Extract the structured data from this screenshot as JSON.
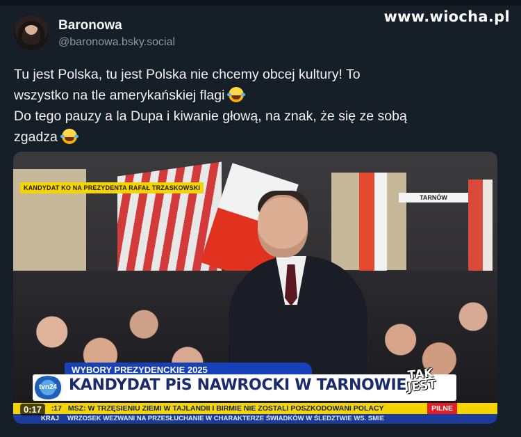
{
  "watermark": "www.wiocha.pl",
  "author": {
    "name": "Baronowa",
    "handle": "@baronowa.bsky.social"
  },
  "post": {
    "line1": "Tu jest Polska, tu jest Polska nie chcemy obcej kultury! To",
    "line2": "wszystko na tle amerykańskiej flagi",
    "line3": "Do tego pauzy a la Dupa i kiwanie głową, na znak, że się ze sobą",
    "line4": "zgadza",
    "emoji_icon": "laughing-with-tears-emoji"
  },
  "video": {
    "timestamp": "0:17",
    "broadcast": {
      "top_label": "KANDYDAT KO NA PREZYDENTA RAFAŁ TRZASKOWSKI",
      "location": "TARNÓW",
      "banner_sub": "WYBORY PREZYDENCKIE 2025",
      "channel_logo": "tvn24",
      "headline": "KANDYDAT PiS NAWROCKI W TARNOWIE",
      "stamp_line1": "TAK",
      "stamp_line2": "JEST",
      "ticker_time": ":17",
      "ticker_text": "MSZ: W TRZĘSIENIU ZIEMI W TAJLANDII I BIRMIE NIE ZOSTALI POSZKODOWANI POLACY",
      "ticker_badge": "PILNE",
      "ticker2_tag": "KRAJ",
      "ticker2_text": "WRZOSEK WEZWANI NA PRZESŁUCHANIE W CHARAKTERZE ŚWIADKÓW W ŚLEDZTWIE WS. SMIE"
    }
  },
  "colors": {
    "background": "#161e27",
    "text": "#f1f3f5",
    "muted": "#8b98a5",
    "chyron_yellow": "#f5d400",
    "tvn_blue": "#1741b8",
    "pilne_red": "#e31e24"
  }
}
